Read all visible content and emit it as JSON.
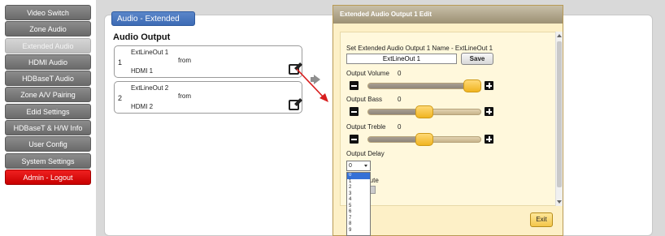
{
  "sidebar": {
    "items": [
      {
        "label": "Video Switch",
        "state": "normal"
      },
      {
        "label": "Zone Audio",
        "state": "normal"
      },
      {
        "label": "Extended Audio",
        "state": "active"
      },
      {
        "label": "HDMI Audio",
        "state": "normal"
      },
      {
        "label": "HDBaseT Audio",
        "state": "normal"
      },
      {
        "label": "Zone A/V Pairing",
        "state": "normal"
      },
      {
        "label": "Edid Settings",
        "state": "normal"
      },
      {
        "label": "HDBaseT & H/W Info",
        "state": "normal"
      },
      {
        "label": "User Config",
        "state": "normal"
      },
      {
        "label": "System Settings",
        "state": "normal"
      },
      {
        "label": "Admin - Logout",
        "state": "logout"
      }
    ]
  },
  "main": {
    "section_tab": "Audio - Extended",
    "section_title": "Audio Output",
    "outputs": [
      {
        "number": "1",
        "name": "ExtLineOut 1",
        "from_label": "from",
        "source": "HDMI 1"
      },
      {
        "number": "2",
        "name": "ExtLineOut 2",
        "from_label": "from",
        "source": "HDMI 2"
      }
    ]
  },
  "dialog": {
    "title": "Extended Audio Output 1 Edit",
    "name_label": "Set Extended Audio Output 1 Name - ExtLineOut 1",
    "name_value": "ExtLineOut 1",
    "save_label": "Save",
    "volume": {
      "label": "Output Volume",
      "value": "0",
      "level": 0.93
    },
    "bass": {
      "label": "Output Bass",
      "value": "0",
      "level": 0.5
    },
    "treble": {
      "label": "Output Treble",
      "value": "0",
      "level": 0.5
    },
    "delay": {
      "label": "Output Delay",
      "selected": "0",
      "options": [
        "0",
        "1",
        "2",
        "3",
        "4",
        "5",
        "6",
        "7",
        "8",
        "9"
      ]
    },
    "mute_label": "Mute",
    "exit_label": "Exit"
  },
  "colors": {
    "logout_red": "#e00000",
    "tab_blue": "#4a78c0",
    "dialog_bg": "#fdf0c7",
    "knob_gold": "#f3c13a",
    "arrow_red": "#d81e1e"
  }
}
